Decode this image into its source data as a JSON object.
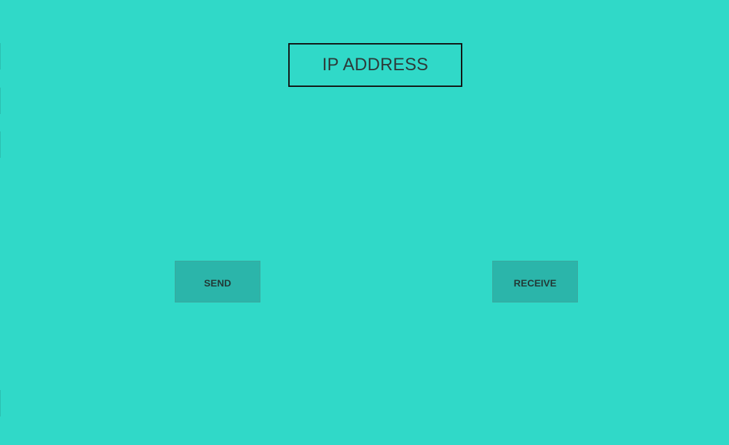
{
  "app": {
    "background": "#30d9c8",
    "ip_address_label": "IP ADDRESS",
    "send_label": "SEND",
    "receive_label": "RECEIVE"
  },
  "colors": {
    "button_background": "#2bb5aa",
    "box_border": "#111111",
    "text": "#2d3b3a"
  }
}
